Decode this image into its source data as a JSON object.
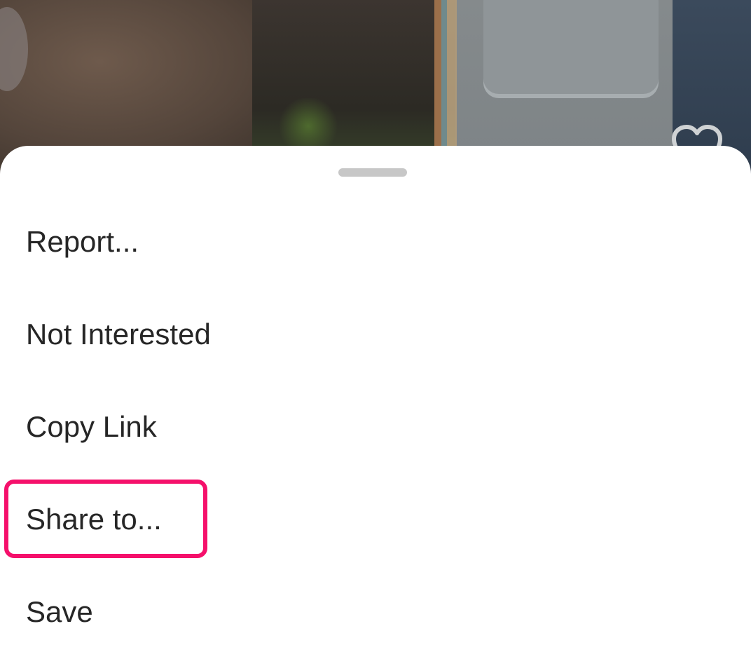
{
  "menu": {
    "items": [
      {
        "label": "Report..."
      },
      {
        "label": "Not Interested"
      },
      {
        "label": "Copy Link"
      },
      {
        "label": "Share to..."
      },
      {
        "label": "Save"
      }
    ]
  },
  "highlight": {
    "target": "Share to...",
    "color": "#f5106b"
  },
  "icons": {
    "like": "heart-outline-icon"
  }
}
